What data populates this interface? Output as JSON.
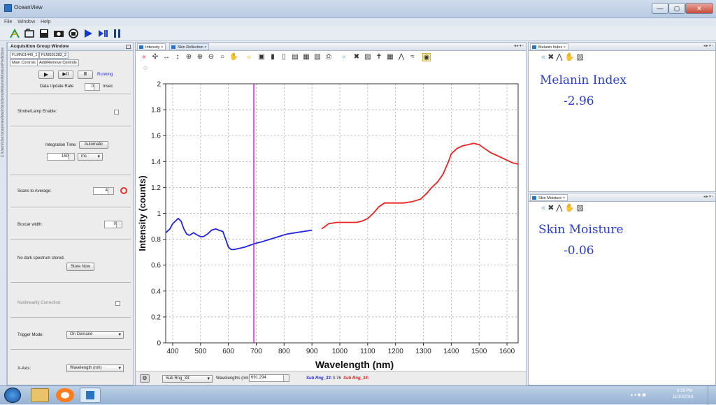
{
  "window": {
    "title": "OceanView",
    "controls": [
      "—",
      "▢",
      "✕"
    ]
  },
  "menu": {
    "items": [
      "File",
      "Window",
      "Help"
    ]
  },
  "toolbar": {
    "icons": [
      "wizard-icon",
      "open-icon",
      "save-icon",
      "snapshot-icon",
      "device-icon",
      "play-icon",
      "play-pause-icon",
      "pause-icon"
    ]
  },
  "side_strip": {
    "text": "C:\\Users\\User\\oceanview\\Main\\SkinDemo\\Melanin\\MoisturePredictions"
  },
  "acquisition": {
    "title": "Acquisition Group Window",
    "device_tabs": [
      "FLMN01449_1",
      "FLMS01282_2"
    ],
    "control_tabs": [
      "Main Controls",
      "Add/Remove Controls"
    ],
    "status": "Running",
    "data_update_rate": {
      "label": "Data Update Rate",
      "value": "0",
      "unit": "msec"
    },
    "strobe_label": "Strobe/Lamp Enable:",
    "integration": {
      "label": "Integration Time:",
      "button": "Automatic",
      "value": "150",
      "unit": "ms"
    },
    "scans": {
      "label": "Scans to Average:",
      "value": "4"
    },
    "boxcar": {
      "label": "Boxcar width:",
      "value": "0"
    },
    "dark": {
      "text": "No dark spectrum stored.",
      "button": "Store Now"
    },
    "nonlinearity_label": "Nonlinearity Correction:",
    "trigger": {
      "label": "Trigger Mode:",
      "value": "On Demand"
    },
    "xaxis": {
      "label": "X-Axis:",
      "value": "Wavelength (nm)"
    }
  },
  "center": {
    "tabs": [
      "Intensity",
      "Skin Reflection"
    ],
    "bottom": {
      "range_select": "Sub Rng_33:",
      "wavelength_label": "Wavelengths (nm)",
      "wavelength_value": "691.294",
      "readout_label1": "Sub Rng_33:",
      "readout_value": "0.76",
      "readout_label2": "Sub Rng_34:"
    }
  },
  "chart_data": {
    "type": "line",
    "xlabel": "Wavelength (nm)",
    "ylabel": "Intensity (counts)",
    "xlim": [
      375,
      1640
    ],
    "ylim": [
      0,
      2
    ],
    "xticks": [
      400,
      500,
      600,
      700,
      800,
      900,
      1000,
      1100,
      1200,
      1300,
      1400,
      1500,
      1600
    ],
    "yticks": [
      0,
      0.2,
      0.4,
      0.6,
      0.8,
      1,
      1.2,
      1.4,
      1.6,
      1.8,
      2
    ],
    "ytick_labels": [
      "0",
      "0.2",
      "0.4",
      "0.6",
      "0.8",
      "1",
      "1.2",
      "1.4",
      "1.6",
      "1.8",
      "2"
    ],
    "grid": true,
    "cursor_x": 691.294,
    "colors": {
      "blue": "#2323e0",
      "red": "#ee2222",
      "cursor": "#e020e0"
    },
    "series": [
      {
        "color": "blue",
        "x": [
          375,
          390,
          400,
          410,
          420,
          430,
          440,
          450,
          460,
          475,
          490,
          500,
          510,
          525,
          540,
          555,
          565,
          580,
          590,
          600,
          610,
          620,
          640,
          660,
          680,
          700,
          720,
          750,
          780,
          810,
          840,
          870,
          900
        ],
        "y": [
          0.85,
          0.88,
          0.92,
          0.94,
          0.96,
          0.94,
          0.88,
          0.84,
          0.83,
          0.85,
          0.83,
          0.82,
          0.82,
          0.84,
          0.87,
          0.88,
          0.87,
          0.86,
          0.8,
          0.74,
          0.72,
          0.72,
          0.73,
          0.74,
          0.755,
          0.77,
          0.78,
          0.8,
          0.82,
          0.84,
          0.85,
          0.86,
          0.87
        ]
      },
      {
        "color": "red",
        "x": [
          935,
          960,
          990,
          1030,
          1060,
          1080,
          1100,
          1120,
          1140,
          1160,
          1180,
          1200,
          1230,
          1260,
          1290,
          1310,
          1330,
          1350,
          1370,
          1390,
          1400,
          1420,
          1440,
          1460,
          1480,
          1500,
          1520,
          1540,
          1560,
          1580,
          1600,
          1620,
          1640
        ],
        "y": [
          0.88,
          0.92,
          0.93,
          0.93,
          0.93,
          0.94,
          0.96,
          1.0,
          1.05,
          1.08,
          1.08,
          1.08,
          1.08,
          1.09,
          1.11,
          1.15,
          1.2,
          1.24,
          1.3,
          1.4,
          1.46,
          1.5,
          1.52,
          1.53,
          1.54,
          1.53,
          1.5,
          1.47,
          1.45,
          1.43,
          1.41,
          1.39,
          1.38
        ]
      }
    ]
  },
  "melanin": {
    "tab": "Melanin Index",
    "title": "Melanin Index",
    "value": "-2.96"
  },
  "moisture": {
    "tab": "Skin Moisture",
    "title": "Skin Moisture",
    "value": "-0.06"
  },
  "taskbar": {
    "time": "8:38 PM",
    "date": "11/10/2016"
  }
}
